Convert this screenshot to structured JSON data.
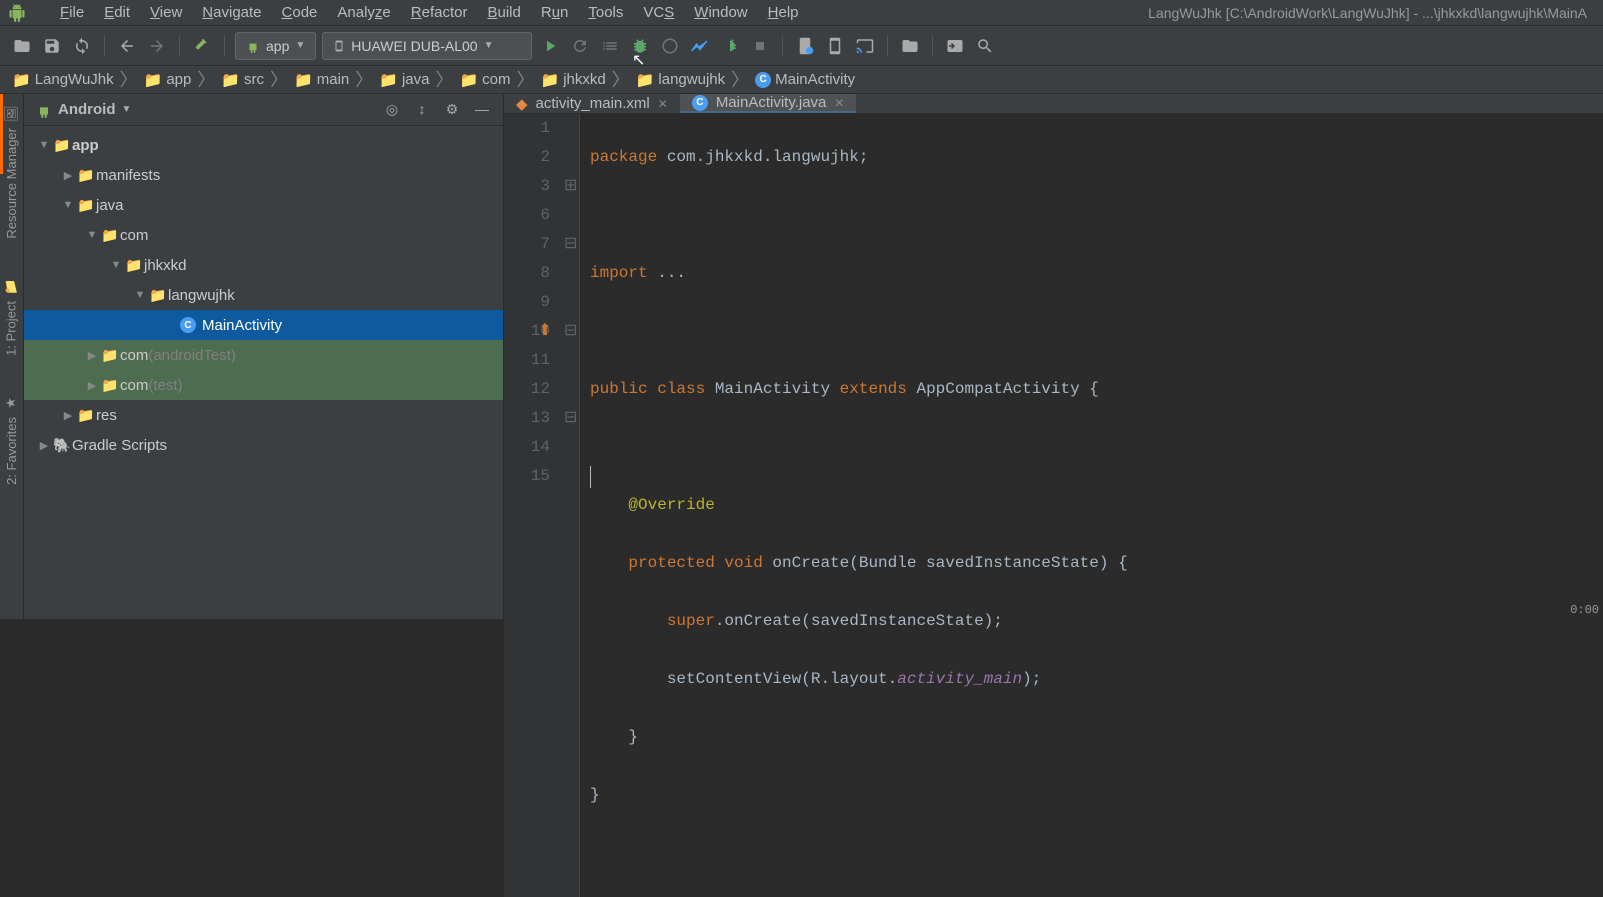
{
  "menubar": [
    "File",
    "Edit",
    "View",
    "Navigate",
    "Code",
    "Analyze",
    "Refactor",
    "Build",
    "Run",
    "Tools",
    "VCS",
    "Window",
    "Help"
  ],
  "window_title": "LangWuJhk [C:\\AndroidWork\\LangWuJhk] - ...\\jhkxkd\\langwujhk\\MainA",
  "toolbar": {
    "config_label": "app",
    "device_label": "HUAWEI DUB-AL00"
  },
  "breadcrumbs": [
    "LangWuJhk",
    "app",
    "src",
    "main",
    "java",
    "com",
    "jhkxkd",
    "langwujhk",
    "MainActivity"
  ],
  "panel": {
    "title": "Android"
  },
  "tree": {
    "app": "app",
    "manifests": "manifests",
    "java": "java",
    "com1": "com",
    "jhkxkd": "jhkxkd",
    "langwujhk": "langwujhk",
    "mainactivity": "MainActivity",
    "com2": "com",
    "androidtest": " (androidTest)",
    "com3": "com",
    "test": " (test)",
    "res": "res",
    "gradle": "Gradle Scripts"
  },
  "tabs": {
    "t1": "activity_main.xml",
    "t2": "MainActivity.java"
  },
  "code": {
    "lines": [
      "1",
      "2",
      "3",
      "6",
      "7",
      "8",
      "9",
      "10",
      "11",
      "12",
      "13",
      "14",
      "15"
    ]
  },
  "rail": {
    "resmgr": "Resource Manager",
    "project": "1: Project",
    "favorites": "2: Favorites"
  },
  "status_time": "0:00"
}
